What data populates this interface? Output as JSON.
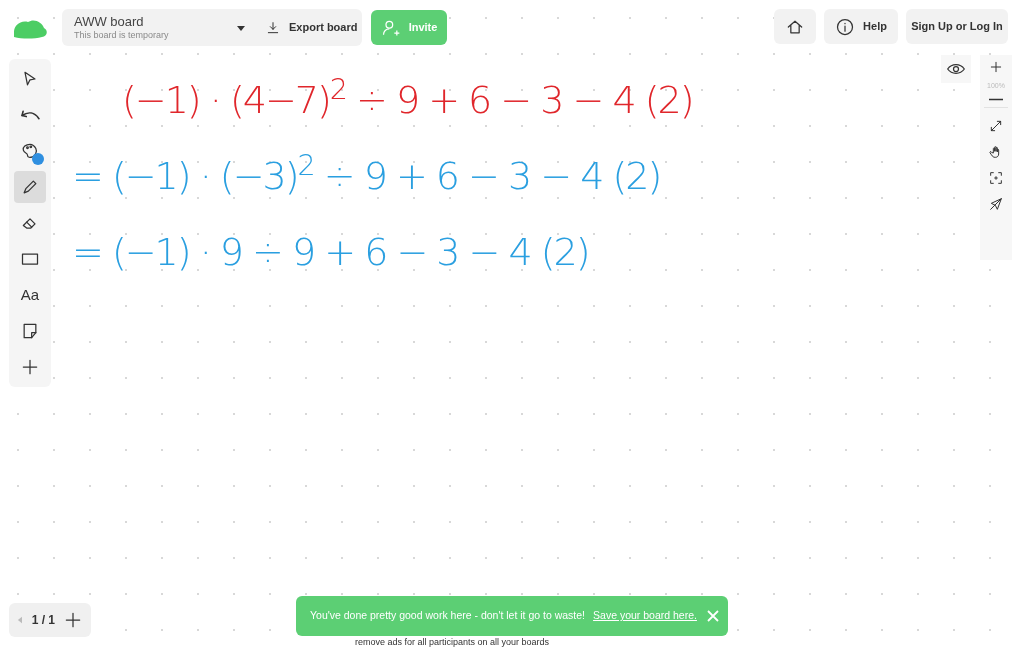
{
  "header": {
    "board_name": "AWW board",
    "board_note": "This board is temporary",
    "export": "Export board",
    "invite": "Invite",
    "help": "Help",
    "login": "Sign Up or Log In"
  },
  "tools": [
    {
      "kind": "select",
      "selected": false
    },
    {
      "kind": "undo",
      "selected": false
    },
    {
      "kind": "palette",
      "selected": false,
      "color": "#2f8fe0"
    },
    {
      "kind": "pen",
      "selected": true
    },
    {
      "kind": "eraser",
      "selected": false
    },
    {
      "kind": "shape",
      "selected": false
    },
    {
      "kind": "text",
      "label": "Aa",
      "selected": false
    },
    {
      "kind": "note",
      "selected": false
    },
    {
      "kind": "add",
      "selected": false
    }
  ],
  "zoom": {
    "level_text": "100%"
  },
  "equations": [
    {
      "text": "(−1) · (4−7)$^{2}$ ÷ 9 + 6 − 3 − 4 (2)",
      "color": "#e0262b"
    },
    {
      "text": "= (−1) · (−3)$^{2}$ ÷ 9 + 6 − 3 − 4 (2)",
      "color": "#2a9fe0"
    },
    {
      "text": "= (−1) · 9 ÷ 9 + 6 − 3 − 4 (2)",
      "color": "#2a9fe0"
    }
  ],
  "pages": {
    "indicator": "1 / 1"
  },
  "toast": {
    "message": "You've done pretty good work here - don't let it go to waste!",
    "link": "Save your board here."
  },
  "footer": "remove ads for all participants on all your boards"
}
